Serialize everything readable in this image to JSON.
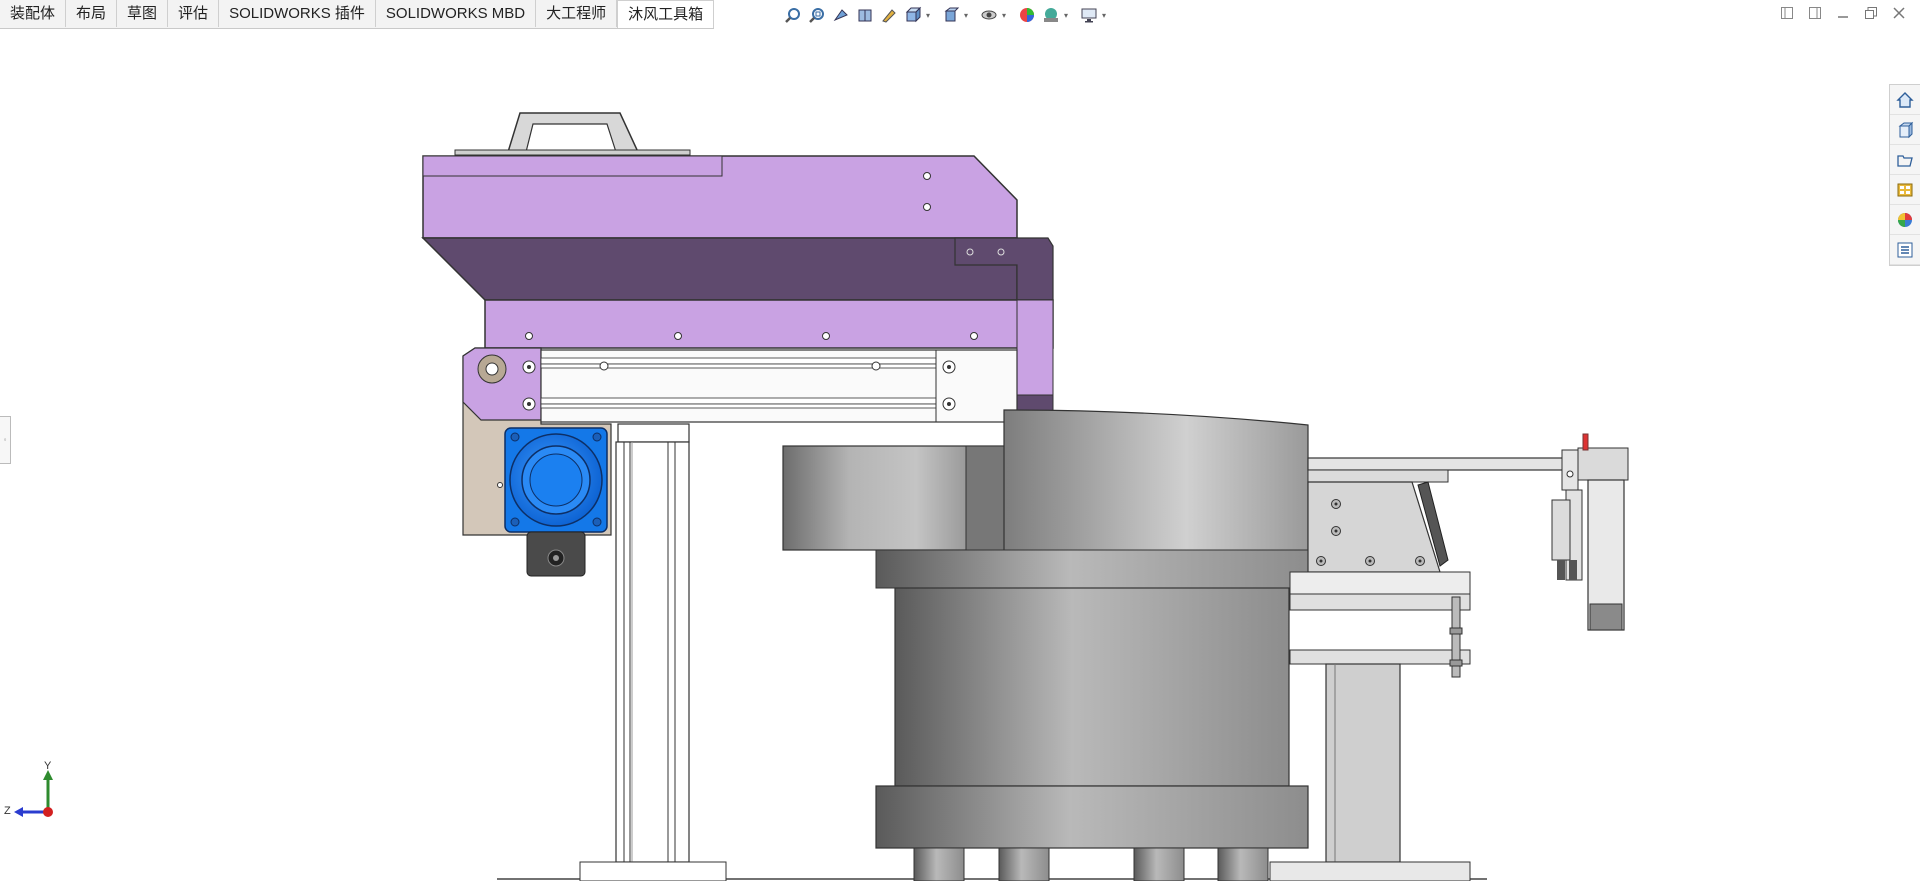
{
  "tabs": [
    {
      "label": "装配体"
    },
    {
      "label": "布局"
    },
    {
      "label": "草图"
    },
    {
      "label": "评估"
    },
    {
      "label": "SOLIDWORKS 插件"
    },
    {
      "label": "SOLIDWORKS MBD"
    },
    {
      "label": "大工程师"
    },
    {
      "label": "沐风工具箱",
      "active": true
    }
  ],
  "headsup_icons": [
    "zoom-to-fit-icon",
    "zoom-to-area-icon",
    "previous-view-icon",
    "section-view-icon",
    "dynamic-annotation-icon",
    "view-orientation-icon",
    "display-style-icon",
    "hide-show-items-icon",
    "edit-appearance-icon",
    "apply-scene-icon",
    "view-settings-icon"
  ],
  "window_controls": [
    "tile-left-icon",
    "tile-right-icon",
    "minimize-icon",
    "restore-icon",
    "close-icon"
  ],
  "task_pane": [
    "solidworks-resources-icon",
    "design-library-icon",
    "file-explorer-icon",
    "view-palette-icon",
    "appearances-icon",
    "custom-properties-icon"
  ],
  "triad": {
    "y_label": "Y",
    "z_label": "Z",
    "y_color": "#2e8b2e",
    "z_color": "#2a3ccf",
    "x_color": "#d22020"
  },
  "colors": {
    "purple_light": "#c9a2e3",
    "purple_dark": "#5f4a6e",
    "motor_blue": "#1478e8",
    "bowl_gray": "#a8a8a8"
  }
}
